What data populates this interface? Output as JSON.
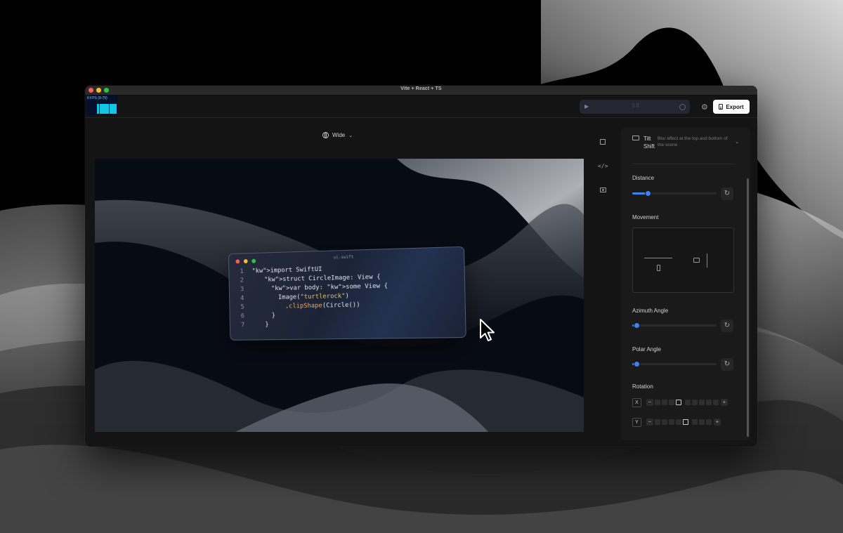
{
  "window": {
    "title": "Vite + React + TS"
  },
  "stats": {
    "fps_label": "8 FPS (8-79)"
  },
  "toolbar": {
    "export_label": "Export",
    "icons": [
      "play-icon",
      "drag-handle-icon",
      "record-icon",
      "gear-icon",
      "document-icon"
    ]
  },
  "viewport": {
    "aspect_label": "Wide",
    "code_card": {
      "filename": "ui.swift",
      "lines": [
        {
          "num": "1",
          "text": "import SwiftUI"
        },
        {
          "num": "2",
          "text": "struct CircleImage: View {"
        },
        {
          "num": "3",
          "text": "var body: some View {"
        },
        {
          "num": "4",
          "text": "Image(\"turtlerock\")"
        },
        {
          "num": "5",
          "text": ".clipShape(Circle())"
        },
        {
          "num": "6",
          "text": "}"
        },
        {
          "num": "7",
          "text": "}"
        }
      ]
    }
  },
  "tools": [
    "focus-frame-icon",
    "code-icon",
    "camera-icon"
  ],
  "panel": {
    "tilt_shift": {
      "title": "Tilt Shift",
      "description": "Blur effect at the top and bottom of the scene"
    },
    "distance": {
      "label": "Distance",
      "value": 0.18
    },
    "movement": {
      "label": "Movement"
    },
    "azimuth": {
      "label": "Azimuth Angle",
      "value": 0.05
    },
    "polar": {
      "label": "Polar Angle",
      "value": 0.05
    },
    "rotation": {
      "label": "Rotation",
      "x": {
        "axis": "X",
        "cells": 9,
        "active_index": 3
      },
      "y": {
        "axis": "Y",
        "cells": 8,
        "active_index": 4
      }
    }
  },
  "colors": {
    "accent": "#3b82f6",
    "export_bg": "#ffffff",
    "fps": "#11c6e5"
  }
}
